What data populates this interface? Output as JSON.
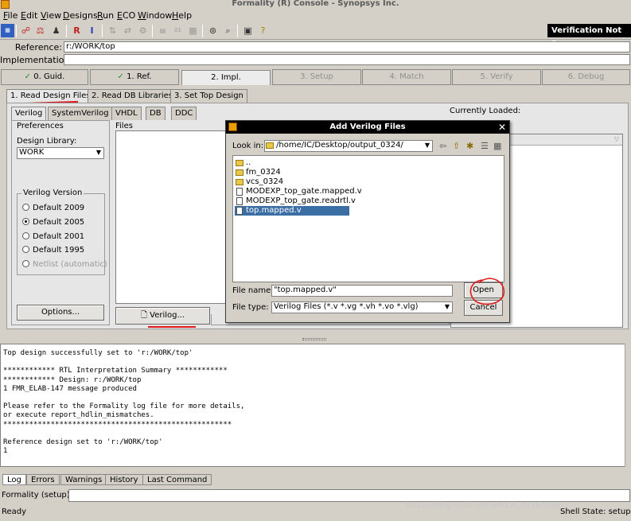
{
  "window": {
    "title": "Formality (R) Console - Synopsys Inc."
  },
  "menu": [
    "File",
    "Edit",
    "View",
    "Designs",
    "Run",
    "ECO",
    "Window",
    "Help"
  ],
  "toolbar": {
    "verification_status": "Verification Not Run",
    "icons": [
      "design-icon",
      "hierarchy-icon",
      "compare-icon",
      "schematic-icon",
      "ref-icon",
      "impl-icon",
      "flow-icon",
      "match-icon",
      "verify-icon",
      "pattern-icon",
      "bits-icon",
      "table-icon",
      "binoculars-icon",
      "find-icon",
      "report-icon",
      "help-icon"
    ]
  },
  "fields": {
    "reference_label": "Reference:",
    "reference_value": "r:/WORK/top",
    "implementation_label": "Implementation:",
    "implementation_value": ""
  },
  "steps": [
    {
      "label": "0. Guid.",
      "state": "done"
    },
    {
      "label": "1. Ref.",
      "state": "done"
    },
    {
      "label": "2. Impl.",
      "state": "active"
    },
    {
      "label": "3. Setup",
      "state": "disabled"
    },
    {
      "label": "4. Match",
      "state": "disabled"
    },
    {
      "label": "5. Verify",
      "state": "disabled"
    },
    {
      "label": "6. Debug",
      "state": "disabled"
    }
  ],
  "impl_tabs": [
    "1. Read Design Files",
    "2. Read DB Libraries",
    "3. Set Top Design"
  ],
  "format_tabs": [
    "Verilog",
    "SystemVerilog",
    "VHDL",
    "DB",
    "DDC"
  ],
  "preferences": {
    "title": "Preferences",
    "design_library_label": "Design Library:",
    "design_library_value": "WORK",
    "verilog_version_label": "Verilog Version",
    "versions": [
      "Default 2009",
      "Default 2005",
      "Default 2001",
      "Default 1995",
      "Netlist (automatic)"
    ],
    "selected_version": "Default 2005",
    "options_button": "Options..."
  },
  "files_panel": {
    "label": "Files",
    "verilog_button": "Verilog...",
    "currently_loaded_label": "Currently Loaded:"
  },
  "dialog": {
    "title": "Add Verilog Files",
    "look_in_label": "Look in:",
    "look_in_value": "/home/IC/Desktop/output_0324/",
    "files": [
      {
        "name": "..",
        "type": "folder"
      },
      {
        "name": "fm_0324",
        "type": "folder"
      },
      {
        "name": "vcs_0324",
        "type": "folder"
      },
      {
        "name": "MODEXP_top_gate.mapped.v",
        "type": "file"
      },
      {
        "name": "MODEXP_top_gate.readrtl.v",
        "type": "file"
      },
      {
        "name": "top.mapped.v",
        "type": "file",
        "selected": true
      }
    ],
    "file_name_label": "File name:",
    "file_name_value": "\"top.mapped.v\"",
    "file_type_label": "File type:",
    "file_type_value": "Verilog Files (*.v *.vg *.vh *.vo *.vlg)",
    "open_button": "Open",
    "cancel_button": "Cancel"
  },
  "console": {
    "text": "Top design successfully set to 'r:/WORK/top'\n\n************ RTL Interpretation Summary ************\n************ Design: r:/WORK/top\n1 FMR_ELAB-147 message produced\n\nPlease refer to the Formality log file for more details,\nor execute report_hdlin_mismatches.\n*****************************************************\n\nReference design set to 'r:/WORK/top'\n1",
    "tabs": [
      "Log",
      "Errors",
      "Warnings",
      "History",
      "Last Command"
    ],
    "prompt_label": "Formality (setup)>",
    "prompt_value": ""
  },
  "status_bar": {
    "left": "Ready",
    "watermark": "https://blog.csdn.net/weixin_48760298",
    "right": "Shell State: setup"
  }
}
